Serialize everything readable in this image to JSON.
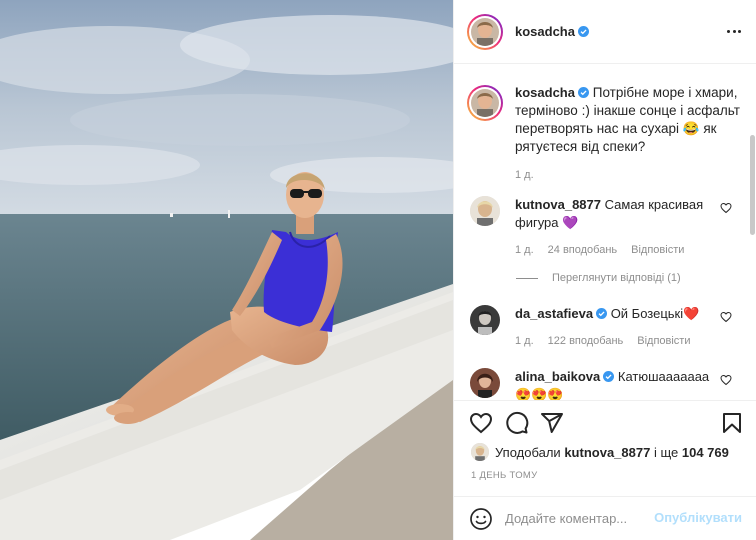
{
  "post": {
    "author": "kosadcha",
    "author_verified": true,
    "caption": "Потрібне море і хмари, терміново :) інакше сонце і асфальт перетворять нас на сухарі 😂 як рятуєтеся від спеки?",
    "caption_time": "1 д."
  },
  "comments": [
    {
      "user": "kutnova_8877",
      "verified": false,
      "text": "Самая красивая фигура",
      "emoji": "💜",
      "time": "1 д.",
      "likes": "24 вподобань",
      "reply_label": "Відповісти"
    },
    {
      "user": "da_astafieva",
      "verified": true,
      "text": "Ой Бозецькі",
      "emoji": "❤️",
      "time": "1 д.",
      "likes": "122 вподобань",
      "reply_label": "Відповісти"
    },
    {
      "user": "alina_baikova",
      "verified": true,
      "text": "Катюшааааааа",
      "emoji": "😍😍😍"
    }
  ],
  "view_replies": "Переглянути відповіді (1)",
  "likes": {
    "prefix": "Уподобали",
    "user": "kutnova_8877",
    "middle": "і ще",
    "count": "104 769"
  },
  "date": "1 ДЕНЬ ТОМУ",
  "comment_box": {
    "placeholder": "Додайте коментар...",
    "publish": "Опублікувати"
  },
  "colors": {
    "verified": "#3897f0",
    "meta_text": "#8e8e8e",
    "publish_disabled": "#b2dffc"
  },
  "icons": {
    "like": "heart-icon",
    "comment": "comment-icon",
    "share": "paper-plane-icon",
    "save": "bookmark-icon",
    "more": "more-icon",
    "emoji": "smile-icon"
  }
}
